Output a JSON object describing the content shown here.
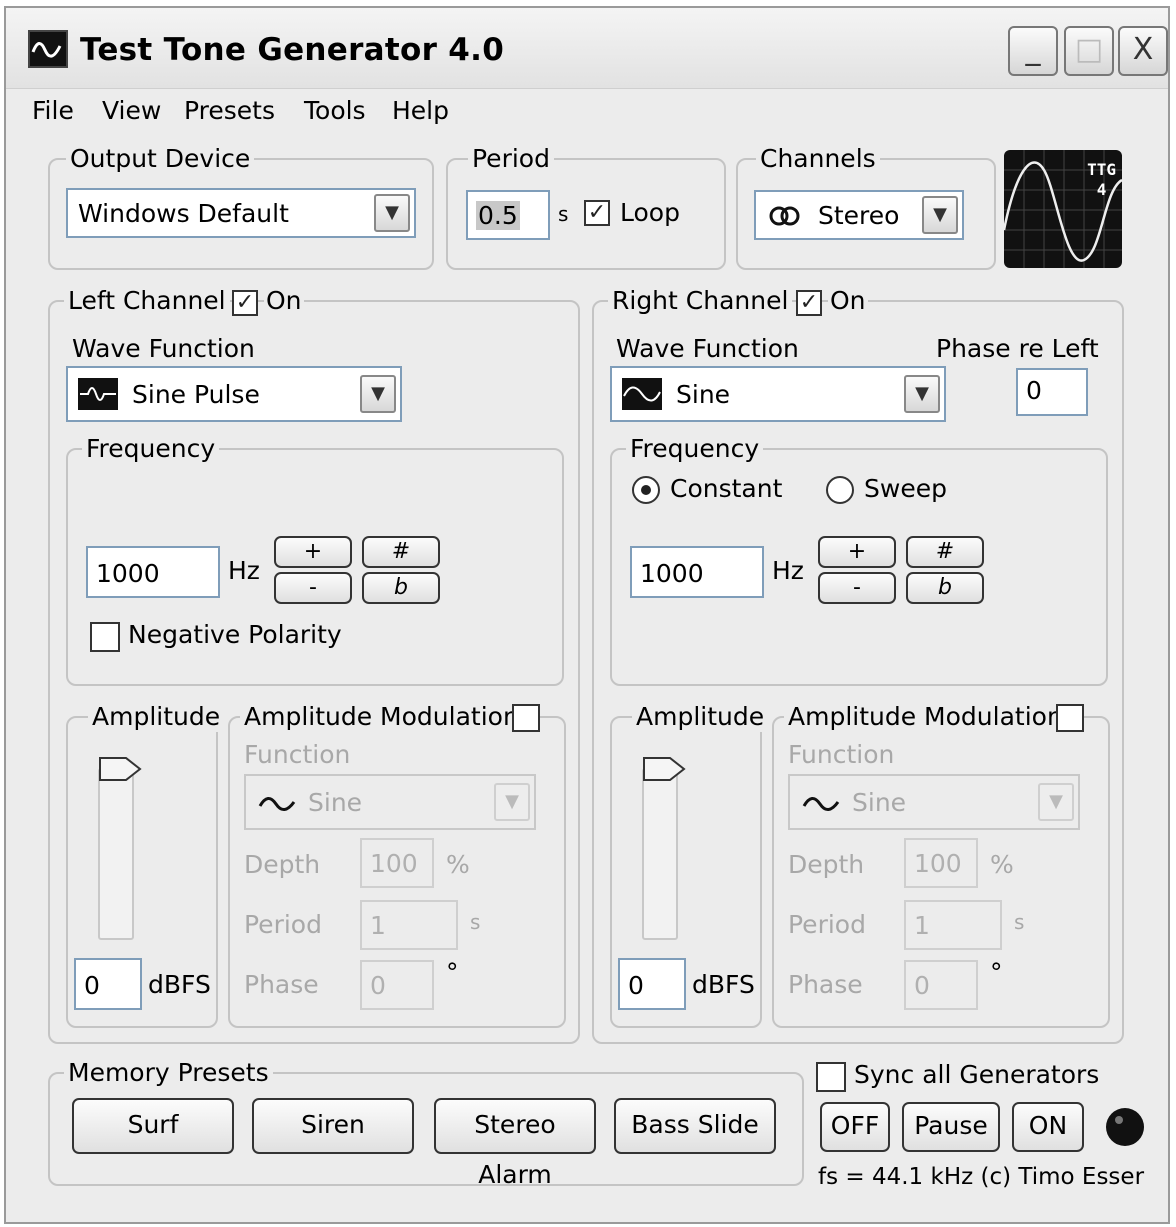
{
  "window": {
    "title": "Test Tone Generator 4.0",
    "controls": {
      "minimize": "_",
      "maximize": "□",
      "close": "X"
    }
  },
  "menu": [
    "File",
    "View",
    "Presets",
    "Tools",
    "Help"
  ],
  "output_device": {
    "legend": "Output Device",
    "value": "Windows Default"
  },
  "period": {
    "legend": "Period",
    "value": "0.5",
    "unit": "s",
    "loop_label": "Loop",
    "loop_checked": true
  },
  "channels": {
    "legend": "Channels",
    "value": "Stereo",
    "icon": "stereo-rings-icon"
  },
  "logo": {
    "line1": "TTG",
    "line2": "4"
  },
  "left": {
    "legend": "Left Channel",
    "on_label": "On",
    "on_checked": true,
    "wave_label": "Wave Function",
    "wave_value": "Sine Pulse",
    "freq_legend": "Frequency",
    "freq_value": "1000",
    "freq_unit": "Hz",
    "plus": "+",
    "minus": "-",
    "sharp": "#",
    "flat": "b",
    "neg_polarity_label": "Negative Polarity",
    "neg_polarity_checked": false,
    "amp_legend": "Amplitude",
    "amp_value": "0",
    "amp_unit": "dBFS",
    "am_legend": "Amplitude Modulation",
    "am_checked": false,
    "am_function_label": "Function",
    "am_function_value": "Sine",
    "depth_label": "Depth",
    "depth_value": "100",
    "depth_unit": "%",
    "period_label": "Period",
    "period_value": "1",
    "period_unit": "s",
    "phase_label": "Phase",
    "phase_value": "0",
    "phase_unit": "°"
  },
  "right": {
    "legend": "Right Channel",
    "on_label": "On",
    "on_checked": true,
    "wave_label": "Wave Function",
    "wave_value": "Sine",
    "phase_re_left_label": "Phase re Left",
    "phase_re_left_value": "0",
    "freq_legend": "Frequency",
    "constant_label": "Constant",
    "sweep_label": "Sweep",
    "mode_selected": "Constant",
    "freq_value": "1000",
    "freq_unit": "Hz",
    "plus": "+",
    "minus": "-",
    "sharp": "#",
    "flat": "b",
    "amp_legend": "Amplitude",
    "amp_value": "0",
    "amp_unit": "dBFS",
    "am_legend": "Amplitude Modulation",
    "am_checked": false,
    "am_function_label": "Function",
    "am_function_value": "Sine",
    "depth_label": "Depth",
    "depth_value": "100",
    "depth_unit": "%",
    "period_label": "Period",
    "period_value": "1",
    "period_unit": "s",
    "phase_label": "Phase",
    "phase_value": "0",
    "phase_unit": "°"
  },
  "memory_presets": {
    "legend": "Memory Presets",
    "buttons": [
      "Surf",
      "Siren",
      "Stereo Alarm",
      "Bass Slide"
    ]
  },
  "sync": {
    "label": "Sync all Generators",
    "checked": false
  },
  "transport": {
    "off": "OFF",
    "pause": "Pause",
    "on": "ON"
  },
  "footer": "fs = 44.1 kHz (c) Timo Esser"
}
